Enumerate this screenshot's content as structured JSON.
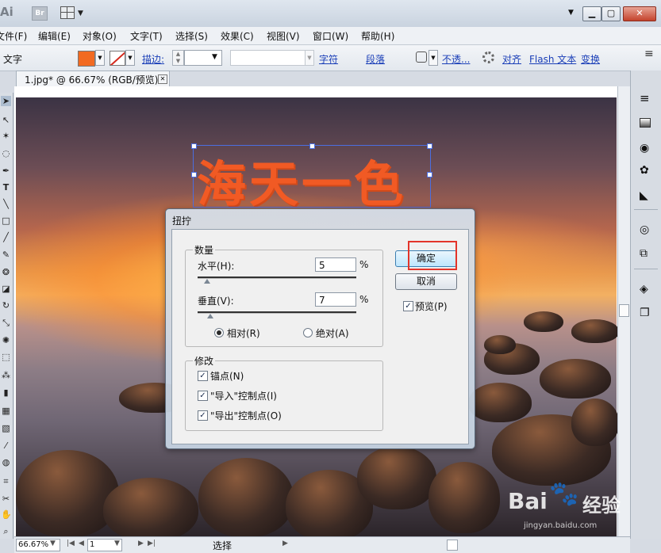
{
  "app": {
    "logo_text": "Ai",
    "bridge_label": "Br"
  },
  "menu": [
    "文件(F)",
    "编辑(E)",
    "对象(O)",
    "文字(T)",
    "选择(S)",
    "效果(C)",
    "视图(V)",
    "窗口(W)",
    "帮助(H)"
  ],
  "control_bar": {
    "tool_label": "文字",
    "fill_color": "#f26a21",
    "stroke_label": "描边:",
    "char_link": "字符",
    "para_link": "段落",
    "opacity_link": "不透...",
    "align_link": "对齐",
    "flash_link": "Flash 文本",
    "transform_link": "变换"
  },
  "document": {
    "tab_title": "1.jpg* @ 66.67% (RGB/预览)",
    "artwork_text": "海天一色",
    "artwork_color": "#f15a24"
  },
  "dialog": {
    "title": "扭拧",
    "amount_group": "数量",
    "horizontal_label": "水平(H):",
    "horizontal_value": "5",
    "horizontal_unit": "%",
    "vertical_label": "垂直(V):",
    "vertical_value": "7",
    "vertical_unit": "%",
    "relative_label": "相对(R)",
    "absolute_label": "绝对(A)",
    "modify_group": "修改",
    "anchor_label": "锚点(N)",
    "in_ctrl_label": "\"导入\"控制点(I)",
    "out_ctrl_label": "\"导出\"控制点(O)",
    "ok_label": "确定",
    "cancel_label": "取消",
    "preview_label": "预览(P)",
    "check_mark": "✓"
  },
  "status": {
    "zoom": "66.67%",
    "page": "1",
    "tool_status": "选择"
  },
  "watermark": {
    "text": "Bai",
    "text2": "经验",
    "url": "jingyan.baidu.com"
  }
}
